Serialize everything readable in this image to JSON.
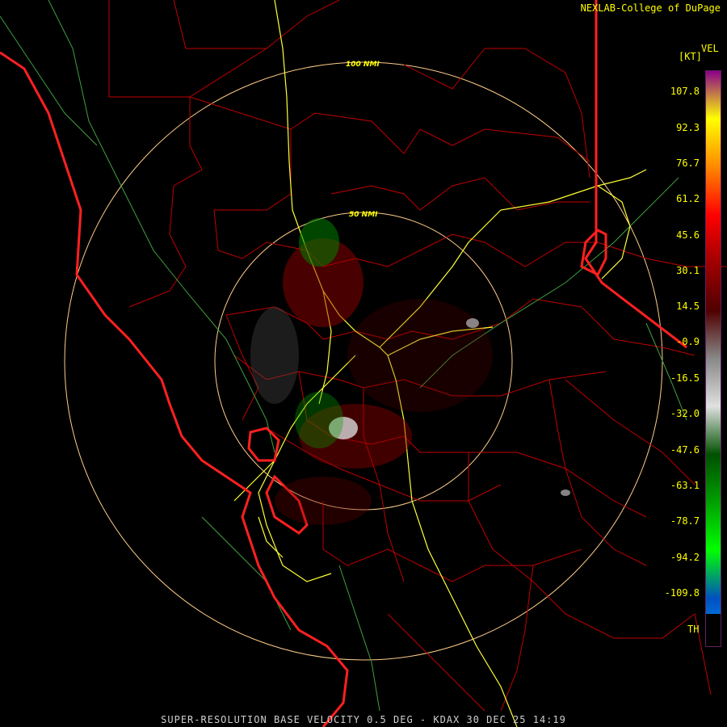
{
  "credit": "NEXLAB-College of DuPage",
  "legend": {
    "product": "VEL",
    "unit": "[KT]",
    "ticks": [
      "107.8",
      "92.3",
      "76.7",
      "61.2",
      "45.6",
      "30.1",
      "14.5",
      "-0.9",
      "-16.5",
      "-32.0",
      "-47.6",
      "-63.1",
      "-78.7",
      "-94.2",
      "-109.8"
    ],
    "th_label": "TH",
    "colors": [
      "#8a008a",
      "#ffff00",
      "#ff8800",
      "#ff0000",
      "#a00000",
      "#500000",
      "#888888",
      "#e0e0e0",
      "#005000",
      "#00a000",
      "#00ff00",
      "#0050c0",
      "#00a0ff"
    ]
  },
  "rings": [
    "50 NMI",
    "100 NMI"
  ],
  "footer": "SUPER-RESOLUTION BASE VELOCITY 0.5 DEG - KDAX 30 DEC 25 14:19",
  "colors": {
    "state_border": "#ff2020",
    "county": "#c00000",
    "highway": "#ffff33",
    "river": "#40a040",
    "ring": "#ffcc88"
  }
}
